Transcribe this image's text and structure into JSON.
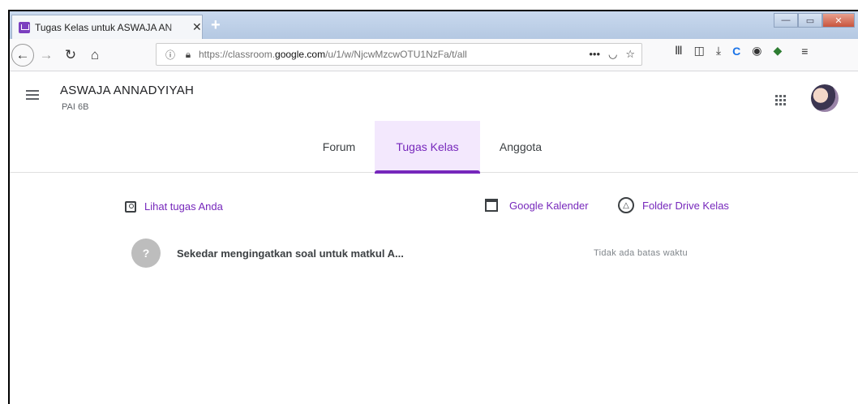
{
  "browser": {
    "tab_title": "Tugas Kelas untuk ASWAJA AN",
    "tab_close": "✕",
    "new_tab": "+",
    "url_prefix": "https://classroom.",
    "url_host": "google.com",
    "url_path": "/u/1/w/NjcwMzcwOTU1NzFa/t/all",
    "url_more": "•••",
    "minimize": "—",
    "maximize": "▭",
    "close": "✕"
  },
  "header": {
    "class_name": "ASWAJA ANNADYIYAH",
    "class_section": "PAI 6B"
  },
  "tabs": [
    {
      "label": "Forum"
    },
    {
      "label": "Tugas Kelas",
      "active": true
    },
    {
      "label": "Anggota"
    }
  ],
  "links": {
    "view_work": "Lihat tugas Anda",
    "calendar": "Google Kalender",
    "drive": "Folder Drive Kelas"
  },
  "assignments": [
    {
      "title": "Sekedar mengingatkan soal untuk matkul A...",
      "due": "Tidak ada batas waktu",
      "icon": "assignment-icon"
    }
  ],
  "colors": {
    "accent": "#7627bb",
    "active_tab_bg": "#f3e8fd"
  }
}
